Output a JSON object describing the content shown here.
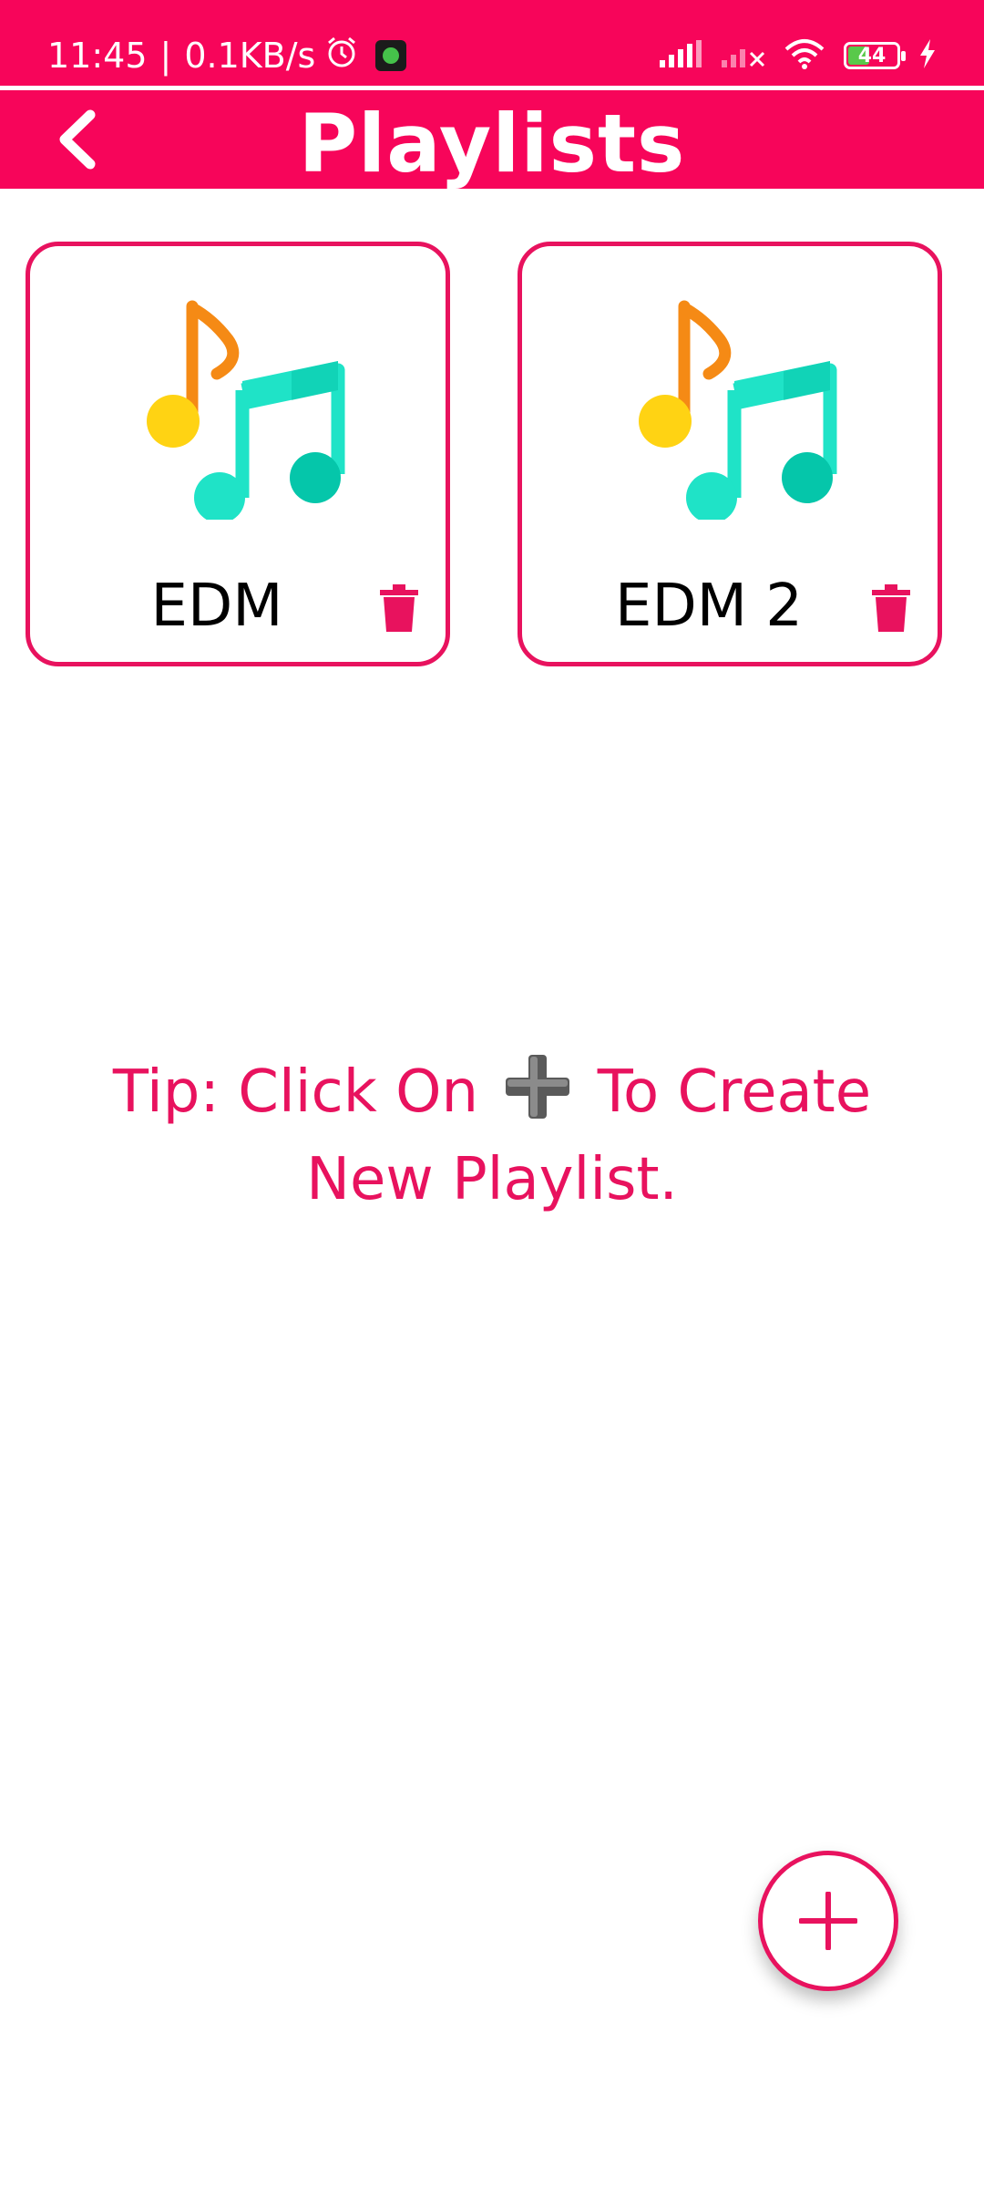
{
  "status_bar": {
    "time": "11:45",
    "network_speed": "0.1KB/s",
    "battery_level": "44",
    "battery_fraction": 0.44,
    "icons": [
      "alarm-icon",
      "app-notification-icon",
      "signal-icon",
      "signal-no-service-icon",
      "wifi-icon",
      "battery-icon",
      "charging-icon"
    ]
  },
  "header": {
    "title": "Playlists",
    "back_icon": "chevron-left-icon"
  },
  "playlists": [
    {
      "name": "EDM",
      "icon": "music-notes-icon",
      "delete_icon": "trash-icon"
    },
    {
      "name": "EDM 2",
      "icon": "music-notes-icon",
      "delete_icon": "trash-icon"
    }
  ],
  "tip": {
    "prefix": "Tip: Click On",
    "icon": "plus-emoji-icon",
    "suffix": "To Create New Playlist."
  },
  "fab": {
    "icon": "plus-icon"
  },
  "colors": {
    "accent": "#f7055a",
    "card_border": "#e8125e",
    "tip_text": "#e8125e",
    "note_orange": "#f58a15",
    "note_yellow": "#ffd313",
    "note_teal": "#1fe3c7",
    "note_teal_dark": "#05c6aa"
  }
}
